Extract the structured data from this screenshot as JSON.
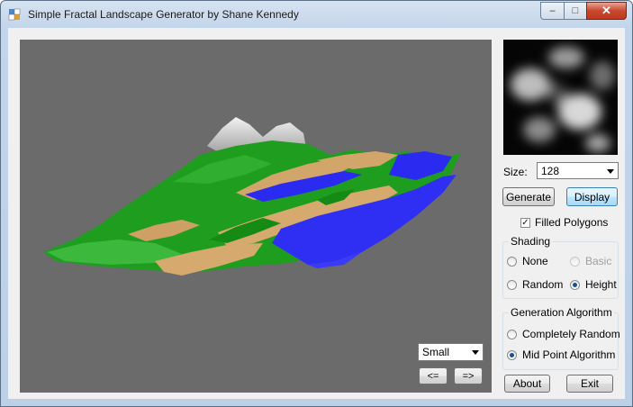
{
  "window": {
    "title": "Simple Fractal Landscape Generator by Shane Kennedy",
    "minimize": "–",
    "maximize": "□",
    "close": "✕"
  },
  "controls": {
    "size_label": "Size:",
    "size_value": "128",
    "generate": "Generate",
    "display": "Display",
    "filled_polygons": "Filled Polygons",
    "filled_polygons_checked": true,
    "check_mark": "✓"
  },
  "shading": {
    "legend": "Shading",
    "options": {
      "none": "None",
      "basic": "Basic",
      "random": "Random",
      "height": "Height"
    },
    "selected": "Height"
  },
  "generation": {
    "legend": "Generation Algorithm",
    "options": {
      "random": "Completely Random",
      "midpoint": "Mid Point Algorithm"
    },
    "selected": "Mid Point Algorithm"
  },
  "view": {
    "scale_value": "Small",
    "prev": "<=",
    "next": "=>"
  },
  "footer": {
    "about": "About",
    "exit": "Exit"
  },
  "icons": {
    "app": "app-window-icon",
    "dropdown": "chevron-down-icon"
  }
}
